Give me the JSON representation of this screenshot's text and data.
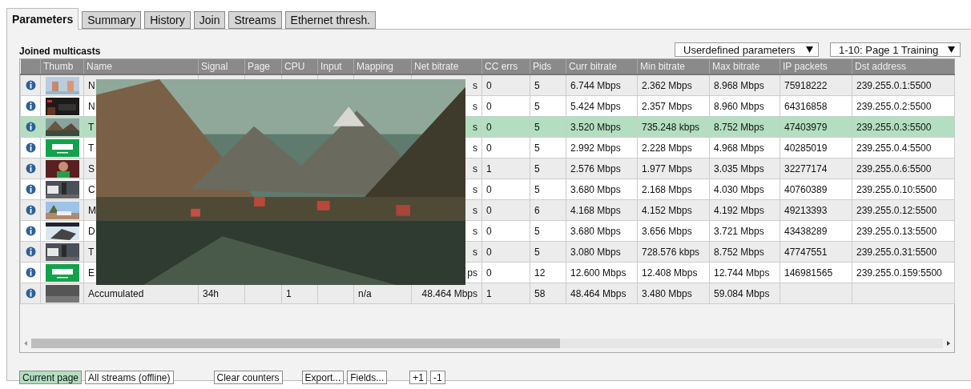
{
  "tabs": [
    {
      "label": "Parameters",
      "selected": true
    },
    {
      "label": "Summary",
      "selected": false
    },
    {
      "label": "History",
      "selected": false
    },
    {
      "label": "Join",
      "selected": false
    },
    {
      "label": "Streams",
      "selected": false
    },
    {
      "label": "Ethernet thresh.",
      "selected": false
    }
  ],
  "section_title": "Joined multicasts",
  "dropdowns": [
    {
      "value": "Userdefined parameters"
    },
    {
      "value": "1-10: Page 1 Training"
    }
  ],
  "table": {
    "columns": [
      "Thumb",
      "Name",
      "Signal",
      "Page",
      "CPU",
      "Input",
      "Mapping",
      "Net bitrate",
      "CC errs",
      "Pids",
      "Curr bitrate",
      "Min bitrate",
      "Max bitrate",
      "IP packets",
      "Dst address"
    ],
    "rows": [
      {
        "selected": false,
        "cells": [
          {
            "kind": "picture"
          },
          "N",
          null,
          null,
          null,
          null,
          null,
          "s",
          "0",
          "5",
          "6.744 Mbps",
          "2.362 Mbps",
          "8.968 Mbps",
          "75918222",
          "239.255.0.1:5500"
        ]
      },
      {
        "selected": false,
        "cells": [
          {
            "kind": "picture"
          },
          "N",
          null,
          null,
          null,
          null,
          null,
          "s",
          "0",
          "5",
          "5.424 Mbps",
          "2.357 Mbps",
          "8.960 Mbps",
          "64316858",
          "239.255.0.2:5500"
        ]
      },
      {
        "selected": true,
        "cells": [
          {
            "kind": "picture"
          },
          "T",
          null,
          null,
          null,
          null,
          null,
          "s",
          "0",
          "5",
          "3.520 Mbps",
          "735.248 kbps",
          "8.752 Mbps",
          "47403979",
          "239.255.0.3:5500"
        ]
      },
      {
        "selected": false,
        "cells": [
          {
            "kind": "picture"
          },
          "T",
          null,
          null,
          null,
          null,
          null,
          "s",
          "0",
          "5",
          "2.992 Mbps",
          "2.228 Mbps",
          "4.968 Mbps",
          "40285019",
          "239.255.0.4:5500"
        ]
      },
      {
        "selected": false,
        "cells": [
          {
            "kind": "picture"
          },
          "S",
          null,
          null,
          null,
          null,
          null,
          "s",
          "1",
          "5",
          "2.576 Mbps",
          "1.977 Mbps",
          "3.035 Mbps",
          "32277174",
          "239.255.0.6:5500"
        ]
      },
      {
        "selected": false,
        "cells": [
          {
            "kind": "picture"
          },
          "C",
          null,
          null,
          null,
          null,
          null,
          "s",
          "0",
          "5",
          "3.680 Mbps",
          "2.168 Mbps",
          "4.030 Mbps",
          "40760389",
          "239.255.0.10:5500"
        ]
      },
      {
        "selected": false,
        "cells": [
          {
            "kind": "picture"
          },
          "M",
          null,
          null,
          null,
          null,
          null,
          "s",
          "0",
          "6",
          "4.168 Mbps",
          "4.152 Mbps",
          "4.192 Mbps",
          "49213393",
          "239.255.0.12:5500"
        ]
      },
      {
        "selected": false,
        "cells": [
          {
            "kind": "picture"
          },
          "D",
          null,
          null,
          null,
          null,
          null,
          "s",
          "0",
          "5",
          "3.680 Mbps",
          "3.656 Mbps",
          "3.721 Mbps",
          "43438289",
          "239.255.0.13:5500"
        ]
      },
      {
        "selected": false,
        "cells": [
          {
            "kind": "picture"
          },
          "T",
          null,
          null,
          null,
          null,
          null,
          "s",
          "0",
          "5",
          "3.080 Mbps",
          "728.576 kbps",
          "8.752 Mbps",
          "47747551",
          "239.255.0.31:5500"
        ]
      },
      {
        "selected": false,
        "cells": [
          {
            "kind": "picture"
          },
          "E",
          null,
          null,
          null,
          null,
          null,
          "ps",
          "0",
          "12",
          "12.600 Mbps",
          "12.408 Mbps",
          "12.744 Mbps",
          "146981565",
          "239.255.0.159:5500"
        ]
      },
      {
        "selected": false,
        "cells": [
          {
            "kind": "picture"
          },
          "Accumulated",
          "34h",
          null,
          "1",
          null,
          "n/a",
          "48.464 Mbps",
          "1",
          "58",
          "48.464 Mbps",
          "3.480 Mbps",
          "59.084 Mbps",
          null,
          null
        ]
      }
    ]
  },
  "preview": {
    "kind": "picture"
  },
  "button_groups": [
    [
      {
        "label": "Current page",
        "selected": true
      },
      {
        "label": "All streams (offline)",
        "selected": false
      }
    ],
    [
      {
        "label": "Clear counters",
        "selected": false
      }
    ],
    [
      {
        "label": "Export...",
        "selected": false
      },
      {
        "label": "Fields...",
        "selected": false
      }
    ],
    [
      {
        "label": "+1",
        "selected": false
      },
      {
        "label": "-1",
        "selected": false
      }
    ]
  ]
}
